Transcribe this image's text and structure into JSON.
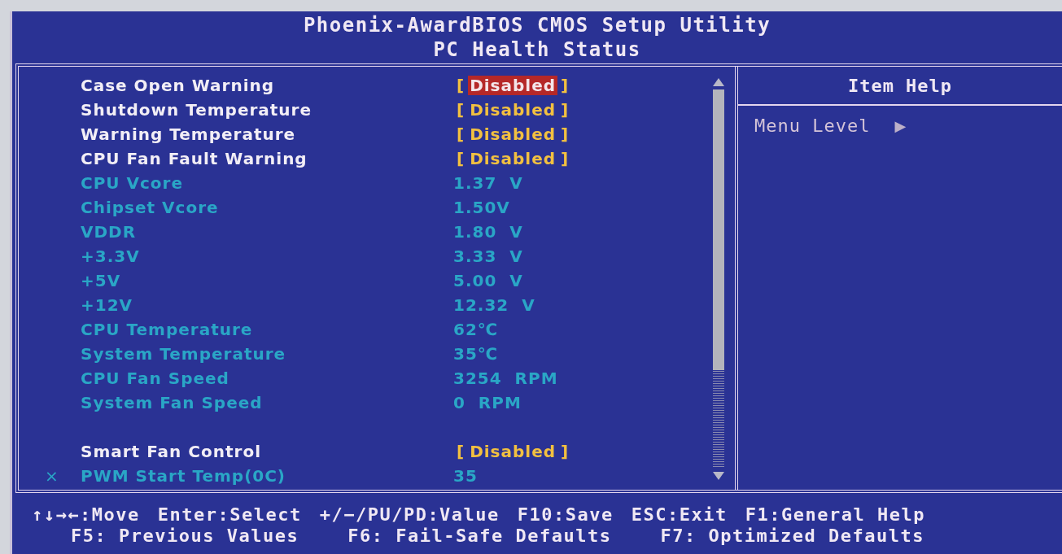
{
  "window": {
    "title": "Phoenix-AwardBIOS CMOS Setup Utility",
    "subtitle": "PC Health Status"
  },
  "groups": [
    [
      {
        "kind": "setting",
        "label": "Case Open Warning",
        "bracket_open": "[",
        "value": "Disabled",
        "bracket_close": "]",
        "selected": true
      },
      {
        "kind": "setting",
        "label": "Shutdown Temperature",
        "bracket_open": "[",
        "value": "Disabled",
        "bracket_close": "]",
        "selected": false
      },
      {
        "kind": "setting",
        "label": "Warning Temperature",
        "bracket_open": "[",
        "value": "Disabled",
        "bracket_close": "]",
        "selected": false
      },
      {
        "kind": "setting",
        "label": "CPU Fan Fault Warning",
        "bracket_open": "[",
        "value": "Disabled",
        "bracket_close": "]",
        "selected": false
      },
      {
        "kind": "reading",
        "label": "CPU Vcore",
        "value": "1.37  V",
        "selected": false
      },
      {
        "kind": "reading",
        "label": "Chipset Vcore",
        "value": "1.50V",
        "selected": false
      },
      {
        "kind": "reading",
        "label": "VDDR",
        "value": "1.80  V",
        "selected": false
      },
      {
        "kind": "reading",
        "label": "+3.3V",
        "value": "3.33  V",
        "selected": false
      },
      {
        "kind": "reading",
        "label": "+5V",
        "value": "5.00  V",
        "selected": false
      },
      {
        "kind": "reading",
        "label": "+12V",
        "value": "12.32  V",
        "selected": false
      },
      {
        "kind": "reading",
        "label": "CPU Temperature",
        "value": "62℃",
        "selected": false
      },
      {
        "kind": "reading",
        "label": "System Temperature",
        "value": "35℃",
        "selected": false
      },
      {
        "kind": "reading",
        "label": "CPU Fan Speed",
        "value": "3254  RPM",
        "selected": false
      },
      {
        "kind": "reading",
        "label": "System Fan Speed",
        "value": "0  RPM",
        "selected": false
      }
    ],
    [
      {
        "kind": "setting",
        "label": "Smart Fan Control",
        "bracket_open": "[",
        "value": "Disabled",
        "bracket_close": "]",
        "selected": false
      },
      {
        "kind": "reading",
        "marker": "×",
        "label": "PWM Start Temp(0C)",
        "value": "35",
        "selected": false
      }
    ]
  ],
  "help": {
    "title": "Item Help",
    "menu_level": "Menu Level",
    "arrow": "▶"
  },
  "footer": [
    [
      "↑↓→←:Move",
      "Enter:Select",
      "+/−/PU/PD:Value",
      "F10:Save",
      "ESC:Exit",
      "F1:General Help"
    ],
    [
      "F5: Previous Values",
      "F6: Fail-Safe Defaults",
      "F7: Optimized Defaults"
    ]
  ]
}
